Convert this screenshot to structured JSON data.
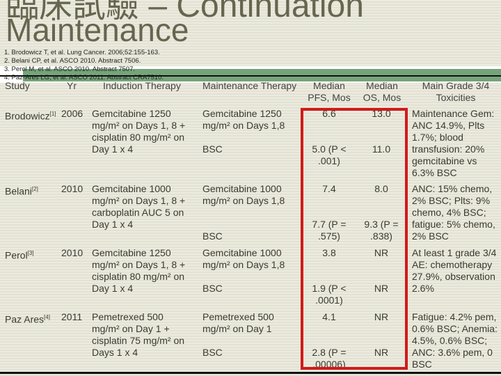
{
  "title": {
    "line1": "臨床試驗 – Continuation",
    "line2": "Maintenance"
  },
  "references": [
    "1. Brodowicz T, et al. Lung Cancer. 2006;52:155-163.",
    "2. Belani CP, et al. ASCO 2010. Abstract 7506.",
    "3. Perol M, et al. ASCO 2010. Abstract 7507.",
    "4. Paz-Ares LG, et al. ASCO 2011. Abstract CRA7510."
  ],
  "headers": {
    "study": "Study",
    "yr": "Yr",
    "induction": "Induction Therapy",
    "maintenance": "Maintenance Therapy",
    "pfs1": "Median",
    "pfs2": "PFS, Mos",
    "os1": "Median",
    "os2": "OS, Mos",
    "tox1": "Main Grade 3/4",
    "tox2": "Toxicities"
  },
  "rows": [
    {
      "study": "Brodowicz",
      "ref": "[1]",
      "yr": "2006",
      "induction": "Gemcitabine 1250 mg/m² on Days 1, 8 + cisplatin 80 mg/m² on Day 1 x 4",
      "maint_a": "Gemcitabine 1250 mg/m² on Days 1,8",
      "maint_b": "BSC",
      "pfs_a": "6.6",
      "pfs_b": "5.0 (P < .001)",
      "os_a": "13.0",
      "os_b": "11.0",
      "tox": "Maintenance Gem: ANC 14.9%, Plts 1.7%; blood transfusion: 20% gemcitabine vs 6.3% BSC"
    },
    {
      "study": "Belani",
      "ref": "[2]",
      "yr": "2010",
      "induction": "Gemcitabine 1000 mg/m² on Days 1, 8 + carboplatin AUC 5 on Day 1 x 4",
      "maint_a": "Gemcitabine 1000 mg/m² on Days 1,8",
      "maint_b": "BSC",
      "pfs_a": "7.4",
      "pfs_b": "7.7 (P = .575)",
      "os_a": "8.0",
      "os_b": "9.3 (P = .838)",
      "tox": "ANC: 15% chemo, 2% BSC; Plts: 9% chemo, 4% BSC; fatigue: 5% chemo, 2% BSC"
    },
    {
      "study": "Perol",
      "ref": "[3]",
      "yr": "2010",
      "induction": "Gemcitabine 1250 mg/m² on Days 1, 8 + cisplatin 80 mg/m² on Day 1 x 4",
      "maint_a": "Gemcitabine 1000 mg/m² on Days 1,8",
      "maint_b": "BSC",
      "pfs_a": "3.8",
      "pfs_b": "1.9 (P < .0001)",
      "os_a": "NR",
      "os_b": "NR",
      "tox": "At least 1 grade 3/4 AE: chemotherapy 27.9%, observation 2.6%"
    },
    {
      "study": "Paz Ares",
      "ref": "[4]",
      "yr": "2011",
      "induction": "Pemetrexed 500 mg/m² on Day 1 + cisplatin 75 mg/m² on Days 1 x 4",
      "maint_a": "Pemetrexed 500 mg/m² on Day 1",
      "maint_b": "BSC",
      "pfs_a": "4.1",
      "pfs_b": "2.8 (P = .00006)",
      "os_a": "NR",
      "os_b": "NR",
      "tox": "Fatigue: 4.2% pem, 0.6% BSC; Anemia: 4.5%, 0.6% BSC; ANC: 3.6% pem, 0 BSC"
    }
  ],
  "colors": {
    "highlight_box": "#d21a1a",
    "header_band": "#76a47a",
    "title": "#666650"
  }
}
